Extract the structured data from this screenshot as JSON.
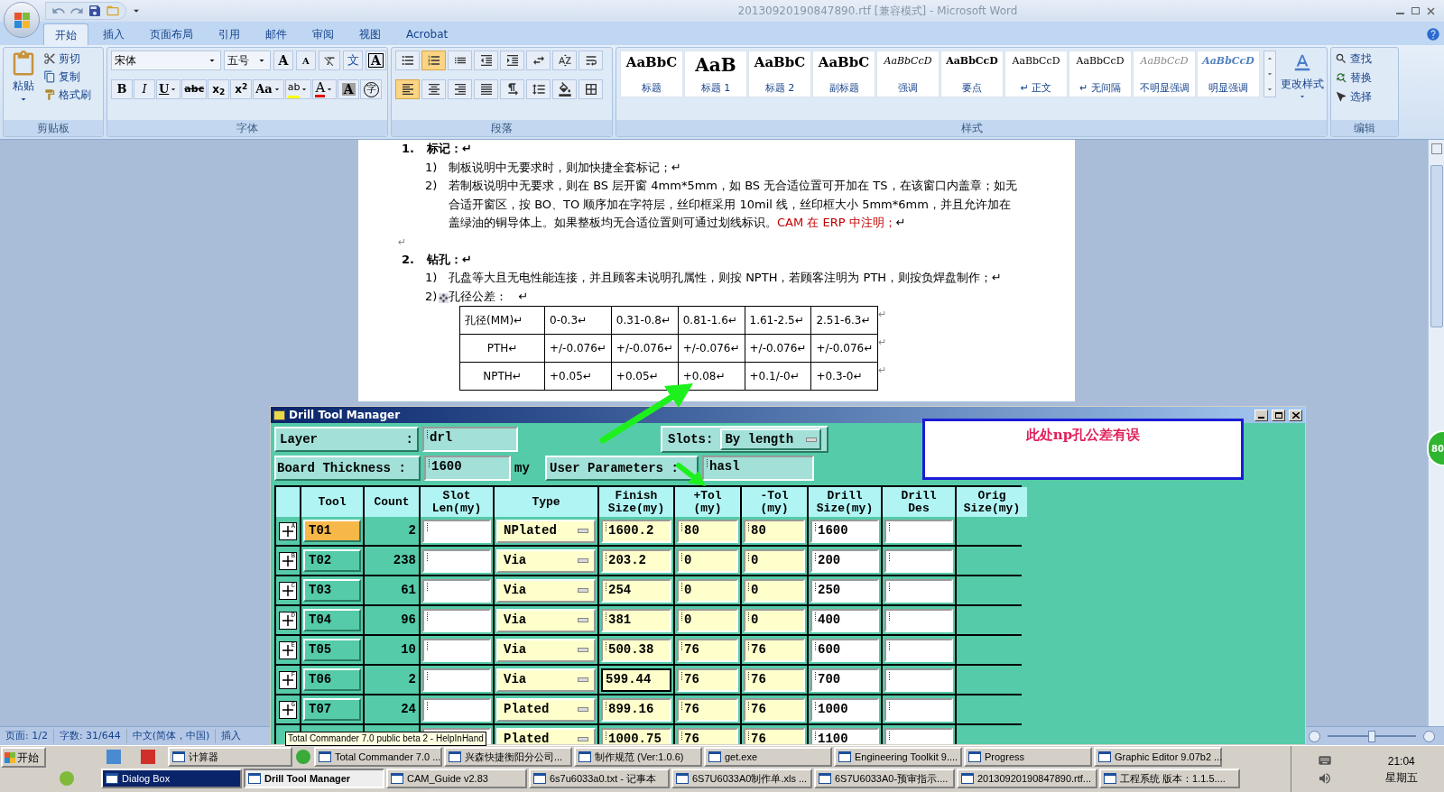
{
  "window": {
    "title": "20130920190847890.rtf [兼容模式] - Microsoft Word"
  },
  "ribbon_tabs": [
    {
      "label": "开始",
      "selected": true
    },
    {
      "label": "插入",
      "selected": false
    },
    {
      "label": "页面布局",
      "selected": false
    },
    {
      "label": "引用",
      "selected": false
    },
    {
      "label": "邮件",
      "selected": false
    },
    {
      "label": "审阅",
      "selected": false
    },
    {
      "label": "视图",
      "selected": false
    },
    {
      "label": "Acrobat",
      "selected": false
    }
  ],
  "clipboard": {
    "paste": "粘贴",
    "cut": "剪切",
    "copy": "复制",
    "painter": "格式刷",
    "label": "剪贴板"
  },
  "font": {
    "name": "宋体",
    "size": "五号",
    "label": "字体",
    "row1": [
      {
        "kind": "grow",
        "text": "A"
      },
      {
        "kind": "shrink",
        "text": "A"
      },
      {
        "kind": "clear"
      },
      {
        "kind": "phonetic",
        "text": "文"
      },
      {
        "kind": "border",
        "text": "A"
      }
    ],
    "row2": [
      {
        "kind": "bold",
        "text": "B"
      },
      {
        "kind": "italic",
        "text": "I"
      },
      {
        "kind": "underline",
        "text": "U"
      },
      {
        "kind": "strike",
        "text": "abc"
      },
      {
        "kind": "sub",
        "text": "x$_{2}$"
      },
      {
        "kind": "sup",
        "text": "x$^{2}$"
      },
      {
        "kind": "case",
        "text": "Aa"
      },
      {
        "kind": "highlight",
        "text": "ab"
      },
      {
        "kind": "color",
        "text": "A"
      },
      {
        "kind": "shade",
        "text": "A"
      },
      {
        "kind": "enclose",
        "text": "字"
      }
    ]
  },
  "paragraph": {
    "label": "段落",
    "row1": [
      {
        "kind": "bullets",
        "selected": false
      },
      {
        "kind": "numbering",
        "selected": true
      },
      {
        "kind": "multilevel",
        "selected": false
      },
      {
        "kind": "outdent",
        "selected": false
      },
      {
        "kind": "indent",
        "selected": false
      },
      {
        "kind": "layout",
        "selected": false
      },
      {
        "kind": "sort",
        "selected": false
      },
      {
        "kind": "marks",
        "selected": false
      }
    ],
    "row2": [
      {
        "kind": "left",
        "selected": true
      },
      {
        "kind": "center",
        "selected": false
      },
      {
        "kind": "right",
        "selected": false
      },
      {
        "kind": "justify",
        "selected": false
      },
      {
        "kind": "distribute",
        "selected": false
      },
      {
        "kind": "spacing",
        "selected": false
      },
      {
        "kind": "fill",
        "selected": false
      },
      {
        "kind": "borders",
        "selected": false
      }
    ]
  },
  "styles": {
    "label": "样式",
    "change": "更改样式",
    "items": [
      {
        "sample": "AaBbC",
        "label": "标题",
        "kind": "title"
      },
      {
        "sample": "AaB",
        "label": "标题 1",
        "kind": "heading1"
      },
      {
        "sample": "AaBbC",
        "label": "标题 2",
        "kind": "heading2"
      },
      {
        "sample": "AaBbC",
        "label": "副标题",
        "kind": "subtitle"
      },
      {
        "sample": "AaBbCcD",
        "label": "强调",
        "kind": "emphasis"
      },
      {
        "sample": "AaBbCcD",
        "label": "要点",
        "kind": "strong"
      },
      {
        "sample": "AaBbCcD",
        "label": "↵ 正文",
        "kind": "normal"
      },
      {
        "sample": "AaBbCcD",
        "label": "↵ 无间隔",
        "kind": "normal"
      },
      {
        "sample": "AaBbCcD",
        "label": "不明显强调",
        "kind": "subtle"
      },
      {
        "sample": "AaBbCcD",
        "label": "明显强调",
        "kind": "intense"
      }
    ]
  },
  "editing": {
    "label": "编辑",
    "find": "查找",
    "replace": "替换",
    "select": "选择"
  },
  "document": {
    "sections": [
      {
        "number": "1.",
        "heading": "标记：↵",
        "items": [
          {
            "number": "1)",
            "text": "制板说明中无要求时，则加快捷全套标记；↵"
          },
          {
            "number": "2)",
            "text": "若制板说明中无要求，则在 BS 层开窗 4mm*5mm，如 BS 无合适位置可开加在 TS，在该窗口内盖章；如无合适开窗区，按 BO、TO 顺序加在字符层，丝印框采用 10mil 线，丝印框大小 5mm*6mm，并且允许加在盖绿油的铜导体上。如果整板均无合适位置则可通过划线标识。",
            "note": "CAM 在 ERP 中注明；",
            "end": "↵"
          }
        ],
        "after": "↵"
      },
      {
        "number": "2.",
        "heading": "钻孔：↵",
        "items": [
          {
            "number": "1)",
            "text": "孔盘等大且无电性能连接，并且顾客未说明孔属性，则按 NPTH，若顾客注明为 PTH，则按负焊盘制作；↵"
          },
          {
            "number": "2)",
            "text": "孔径公差：   ↵"
          }
        ]
      }
    ],
    "table": {
      "header": [
        "孔径(MM)↵",
        "0-0.3↵",
        "0.31-0.8↵",
        "0.81-1.6↵",
        "1.61-2.5↵",
        "2.51-6.3↵"
      ],
      "rows": [
        [
          "PTH↵",
          "+/-0.076↵",
          "+/-0.076↵",
          "+/-0.076↵",
          "+/-0.076↵",
          "+/-0.076↵"
        ],
        [
          "NPTH↵",
          "+0.05↵",
          "+0.05↵",
          "+0.08↵",
          "+0.1/-0↵",
          "+0.3-0↵"
        ]
      ],
      "row_end": "↵"
    }
  },
  "drill_manager": {
    "title": "Drill Tool Manager",
    "layer_label": "Layer",
    "layer_colon": ":",
    "layer_value": "drl",
    "slots_label": "Slots:",
    "slots_value": "By length",
    "thickness_label": "Board Thickness :",
    "thickness_value": "1600",
    "thickness_unit": "my",
    "params_label": "User Parameters :",
    "params_value": "hasl",
    "note": "此处np孔公差有误",
    "columns": [
      "Tool",
      "Count",
      "Slot\nLen(my)",
      "Type",
      "Finish\nSize(my)",
      "+Tol\n(my)",
      "-Tol\n(my)",
      "Drill\nSize(my)",
      "Drill\nDes",
      "Orig\nSize(my)"
    ],
    "rows": [
      {
        "mark": "A",
        "tool": "T01",
        "selected": true,
        "count": "2",
        "type": "NPlated",
        "finish": "1600.2",
        "focused": false,
        "plus_tol": "80",
        "minus_tol": "80",
        "drill_size": "1600"
      },
      {
        "mark": "B",
        "tool": "T02",
        "selected": false,
        "count": "238",
        "type": "Via",
        "finish": "203.2",
        "focused": false,
        "plus_tol": "0",
        "minus_tol": "0",
        "drill_size": "200"
      },
      {
        "mark": "C",
        "tool": "T03",
        "selected": false,
        "count": "61",
        "type": "Via",
        "finish": "254",
        "focused": false,
        "plus_tol": "0",
        "minus_tol": "0",
        "drill_size": "250"
      },
      {
        "mark": "D",
        "tool": "T04",
        "selected": false,
        "count": "96",
        "type": "Via",
        "finish": "381",
        "focused": false,
        "plus_tol": "0",
        "minus_tol": "0",
        "drill_size": "400"
      },
      {
        "mark": "E",
        "tool": "T05",
        "selected": false,
        "count": "10",
        "type": "Via",
        "finish": "500.38",
        "focused": false,
        "plus_tol": "76",
        "minus_tol": "76",
        "drill_size": "600"
      },
      {
        "mark": "F",
        "tool": "T06",
        "selected": false,
        "count": "2",
        "type": "Via",
        "finish": "599.44",
        "focused": true,
        "plus_tol": "76",
        "minus_tol": "76",
        "drill_size": "700"
      },
      {
        "mark": "G",
        "tool": "T07",
        "selected": false,
        "count": "24",
        "type": "Plated",
        "finish": "899.16",
        "focused": false,
        "plus_tol": "76",
        "minus_tol": "76",
        "drill_size": "1000"
      },
      {
        "type": "Plated",
        "selected": false,
        "finish": "1000.75",
        "focused": false,
        "plus_tol": "76",
        "minus_tol": "76",
        "drill_size": "1100"
      }
    ]
  },
  "side_badge": "80",
  "status_bar": [
    "页面: 1/2",
    "字数: 31/644",
    "中文(简体，中国)",
    "插入"
  ],
  "zoom": {
    "level": 0.5
  },
  "tooltip": "Total Commander 7.0 public beta 2 - HelpInHand",
  "taskbar": {
    "start": "开始",
    "row1": [
      {
        "label": "计算器",
        "kind": "normal"
      },
      {
        "label": "Total Commander 7.0 ...",
        "kind": "normal"
      },
      {
        "label": "兴森快捷衡阳分公司...",
        "kind": "normal"
      },
      {
        "label": "制作规范 (Ver:1.0.6)",
        "kind": "normal"
      },
      {
        "label": "get.exe",
        "kind": "normal"
      },
      {
        "label": "Engineering Toolkit 9....",
        "kind": "normal"
      },
      {
        "label": "Progress",
        "kind": "normal"
      },
      {
        "label": "Graphic Editor 9.07b2 ...",
        "kind": "normal"
      }
    ],
    "row2": [
      {
        "label": "Dialog Box",
        "kind": "flashing"
      },
      {
        "label": "Drill Tool Manager",
        "kind": "active"
      },
      {
        "label": "CAM_Guide v2.83",
        "kind": "normal"
      },
      {
        "label": "6s7u6033a0.txt - 记事本",
        "kind": "normal"
      },
      {
        "label": "6S7U6033A0制作单.xls ...",
        "kind": "normal"
      },
      {
        "label": "6S7U6033A0-预审指示....",
        "kind": "normal"
      },
      {
        "label": "20130920190847890.rtf...",
        "kind": "normal"
      },
      {
        "label": "工程系统  版本：1.1.5....",
        "kind": "normal"
      }
    ],
    "clock": "21:04",
    "weekday": "星期五"
  }
}
